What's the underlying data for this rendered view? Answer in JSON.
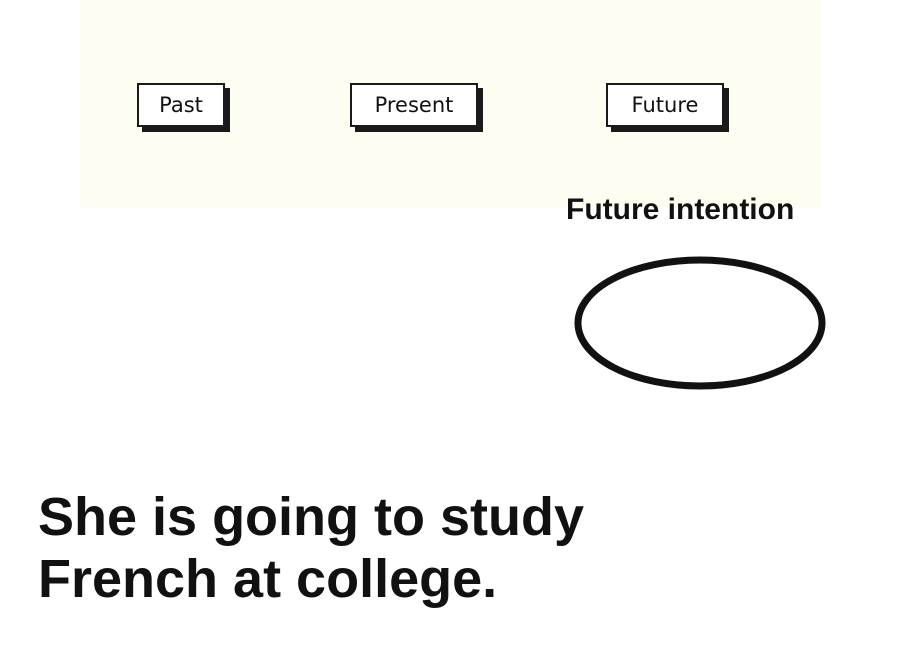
{
  "timeline": {
    "labels": [
      "Past",
      "Present",
      "Future"
    ]
  },
  "annotation": {
    "caption": "Future intention"
  },
  "example": {
    "line1": "She is going to study",
    "line2": "French at college."
  },
  "colors": {
    "ink": "#111111",
    "band": "#fdfdf2",
    "background": "#ffffff"
  }
}
